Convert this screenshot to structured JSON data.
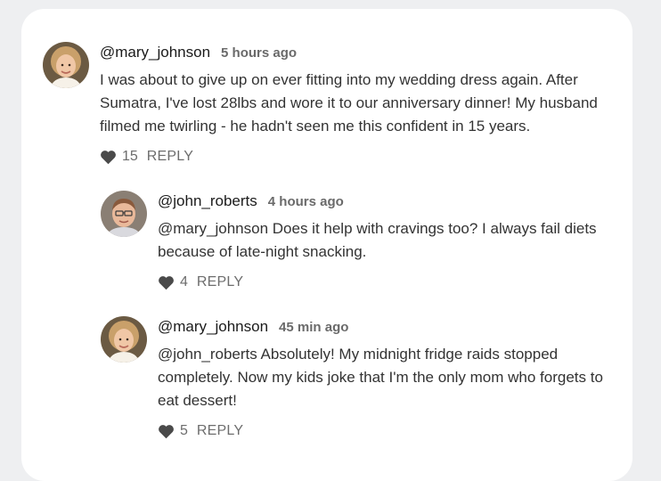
{
  "comments": [
    {
      "username": "@mary_johnson",
      "time": "5 hours ago",
      "text": "I was about to give up on ever fitting into my wedding dress again. After Sumatra, I've lost 28lbs and wore it to our anniversary dinner! My husband filmed me twirling - he hadn't seen me this confident in 15 years.",
      "likes": "15",
      "reply_label": "REPLY",
      "avatar": "woman-avatar"
    },
    {
      "username": "@john_roberts",
      "time": "4 hours ago",
      "text": "@mary_johnson Does it help with cravings too? I always fail diets because of late-night snacking.",
      "likes": "4",
      "reply_label": "REPLY",
      "avatar": "man-avatar"
    },
    {
      "username": "@mary_johnson",
      "time": "45 min ago",
      "text": "@john_roberts Absolutely! My midnight fridge raids stopped completely. Now my kids joke that I'm the only mom who forgets to eat dessert!",
      "likes": "5",
      "reply_label": "REPLY",
      "avatar": "woman-avatar"
    }
  ],
  "colors": {
    "background": "#eeeff1",
    "card": "#ffffff",
    "username": "#1b1b1b",
    "meta": "#6a6a6a",
    "heart": "#4a4a4a"
  }
}
